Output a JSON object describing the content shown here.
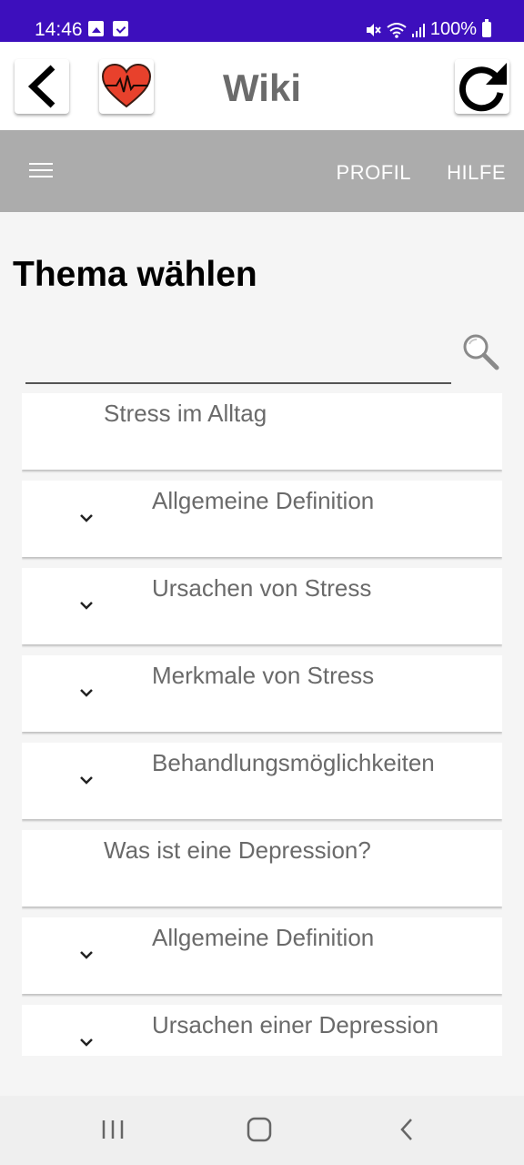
{
  "status_bar": {
    "time": "14:46",
    "battery": "100%",
    "icons_left": [
      "gallery-icon",
      "checkbox-icon"
    ],
    "icons_right": [
      "mute-icon",
      "wifi-icon",
      "signal-icon",
      "battery-icon"
    ]
  },
  "header": {
    "title": "Wiki",
    "icons": [
      "back-arrow-icon",
      "heart-pulse-icon",
      "refresh-icon"
    ]
  },
  "toolbar": {
    "menu_icon": "hamburger-icon",
    "links": [
      "PROFIL",
      "HILFE"
    ]
  },
  "main": {
    "title": "Thema wählen",
    "search": {
      "placeholder": "",
      "value": "",
      "icon": "search-icon"
    },
    "items": [
      {
        "label": "Stress im Alltag",
        "type": "topic"
      },
      {
        "label": "Allgemeine Definition",
        "type": "subtopic"
      },
      {
        "label": "Ursachen von Stress",
        "type": "subtopic"
      },
      {
        "label": "Merkmale von Stress",
        "type": "subtopic"
      },
      {
        "label": "Behandlungsmöglichkeiten",
        "type": "subtopic"
      },
      {
        "label": "Was ist eine Depression?",
        "type": "topic"
      },
      {
        "label": "Allgemeine Definition",
        "type": "subtopic"
      },
      {
        "label": "Ursachen einer Depression",
        "type": "subtopic"
      }
    ]
  },
  "colors": {
    "status_bar": "#3d0fbd",
    "toolbar": "#acacac",
    "title_gray": "#6b6b6b",
    "heart_red": "#e8412c"
  },
  "system_nav": [
    "recent-apps-icon",
    "home-icon",
    "back-icon"
  ]
}
